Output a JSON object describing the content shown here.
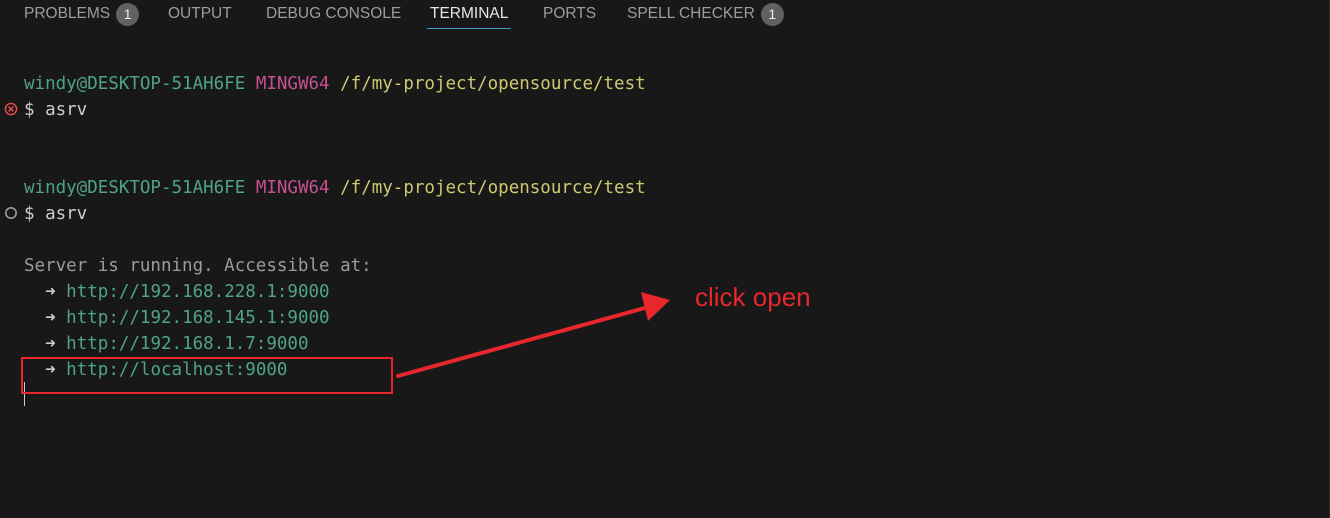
{
  "tabs": [
    {
      "label": "PROBLEMS",
      "badge": "1",
      "active": false
    },
    {
      "label": "OUTPUT",
      "active": false
    },
    {
      "label": "DEBUG CONSOLE",
      "active": false
    },
    {
      "label": "TERMINAL",
      "active": true
    },
    {
      "label": "PORTS",
      "active": false
    },
    {
      "label": "SPELL CHECKER",
      "badge": "1",
      "active": false
    }
  ],
  "terminal": {
    "sessions": [
      {
        "user_host": "windy@DESKTOP-51AH6FE",
        "msystem": "MINGW64",
        "cwd": "/f/my-project/opensource/test",
        "prompt": "$ ",
        "command": "asrv",
        "status": "error"
      },
      {
        "user_host": "windy@DESKTOP-51AH6FE",
        "msystem": "MINGW64",
        "cwd": "/f/my-project/opensource/test",
        "prompt": "$ ",
        "command": "asrv",
        "status": "running"
      }
    ],
    "output_heading": "Server is running. Accessible at:",
    "arrow_glyph": "➜",
    "urls": [
      "http://192.168.228.1:9000",
      "http://192.168.145.1:9000",
      "http://192.168.1.7:9000",
      "http://localhost:9000"
    ]
  },
  "annotation": {
    "text": "click open",
    "color": "#e8272d"
  },
  "colors": {
    "background": "#181818",
    "user_host": "#4fa486",
    "msystem": "#c94f93",
    "cwd": "#cfc86f",
    "url": "#4fa486",
    "active_tab_underline": "#3d9ec4",
    "error_icon": "#f14c4c"
  }
}
